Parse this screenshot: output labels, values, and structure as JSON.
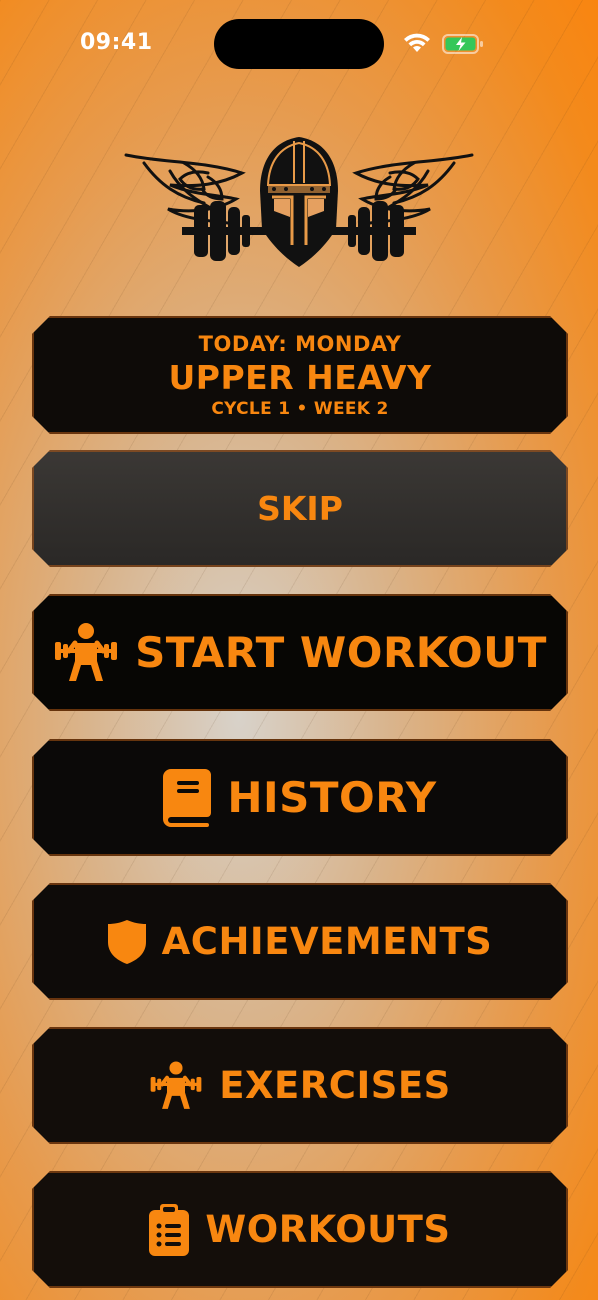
{
  "status_bar": {
    "time": "09:41",
    "icons": [
      "wifi-icon",
      "battery-charging-icon"
    ],
    "battery_color": "#34c759"
  },
  "logo": {
    "icon": "viking-helmet-barbell-logo"
  },
  "today": {
    "day_label": "TODAY: MONDAY",
    "workout_name": "UPPER HEAVY",
    "cycle_label": "CYCLE 1 • WEEK 2"
  },
  "buttons": {
    "skip": {
      "label": "SKIP"
    },
    "start_workout": {
      "label": "START WORKOUT",
      "icon": "weightlifter-icon"
    },
    "history": {
      "label": "HISTORY",
      "icon": "book-icon"
    },
    "achievements": {
      "label": "ACHIEVEMENTS",
      "icon": "shield-icon"
    },
    "exercises": {
      "label": "EXERCISES",
      "icon": "weightlifter-icon"
    },
    "workouts": {
      "label": "WORKOUTS",
      "icon": "clipboard-list-icon"
    }
  },
  "colors": {
    "accent": "#f88710",
    "card_dark": "#0c0a08",
    "skip_card": "#343130"
  }
}
